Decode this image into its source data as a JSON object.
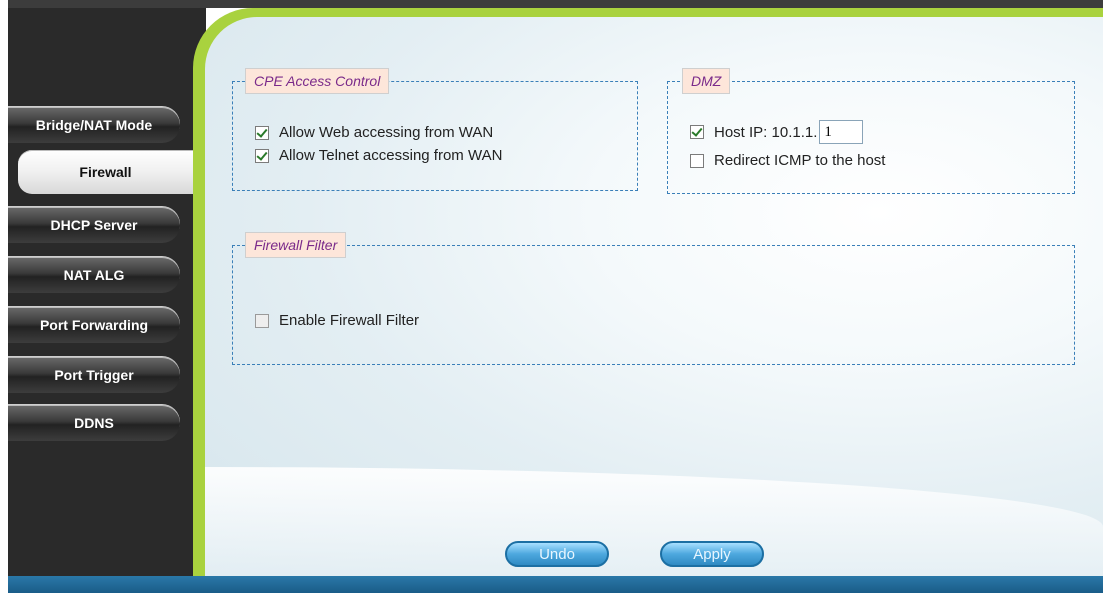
{
  "sidebar": {
    "items": [
      {
        "label": "Bridge/NAT Mode"
      },
      {
        "label": "Firewall"
      },
      {
        "label": "DHCP Server"
      },
      {
        "label": "NAT ALG"
      },
      {
        "label": "Port Forwarding"
      },
      {
        "label": "Port Trigger"
      },
      {
        "label": "DDNS"
      }
    ],
    "active": "Firewall"
  },
  "cpe_access": {
    "title": "CPE Access Control",
    "web": {
      "label": "Allow Web accessing from WAN",
      "checked": true
    },
    "telnet": {
      "label": "Allow Telnet accessing from WAN",
      "checked": true
    }
  },
  "dmz": {
    "title": "DMZ",
    "host": {
      "label": "Host IP: 10.1.1.",
      "value": "1",
      "checked": true
    },
    "icmp": {
      "label": "Redirect ICMP to the host",
      "checked": false
    }
  },
  "firewall_filter": {
    "title": "Firewall Filter",
    "enable": {
      "label": "Enable Firewall Filter",
      "checked": false
    }
  },
  "buttons": {
    "undo": "Undo",
    "apply": "Apply"
  },
  "colors": {
    "accent_green": "#a9d23e",
    "legend_text": "#7a2a8a",
    "box_border": "#3a7fb8",
    "button_blue": "#2f8ac3"
  }
}
